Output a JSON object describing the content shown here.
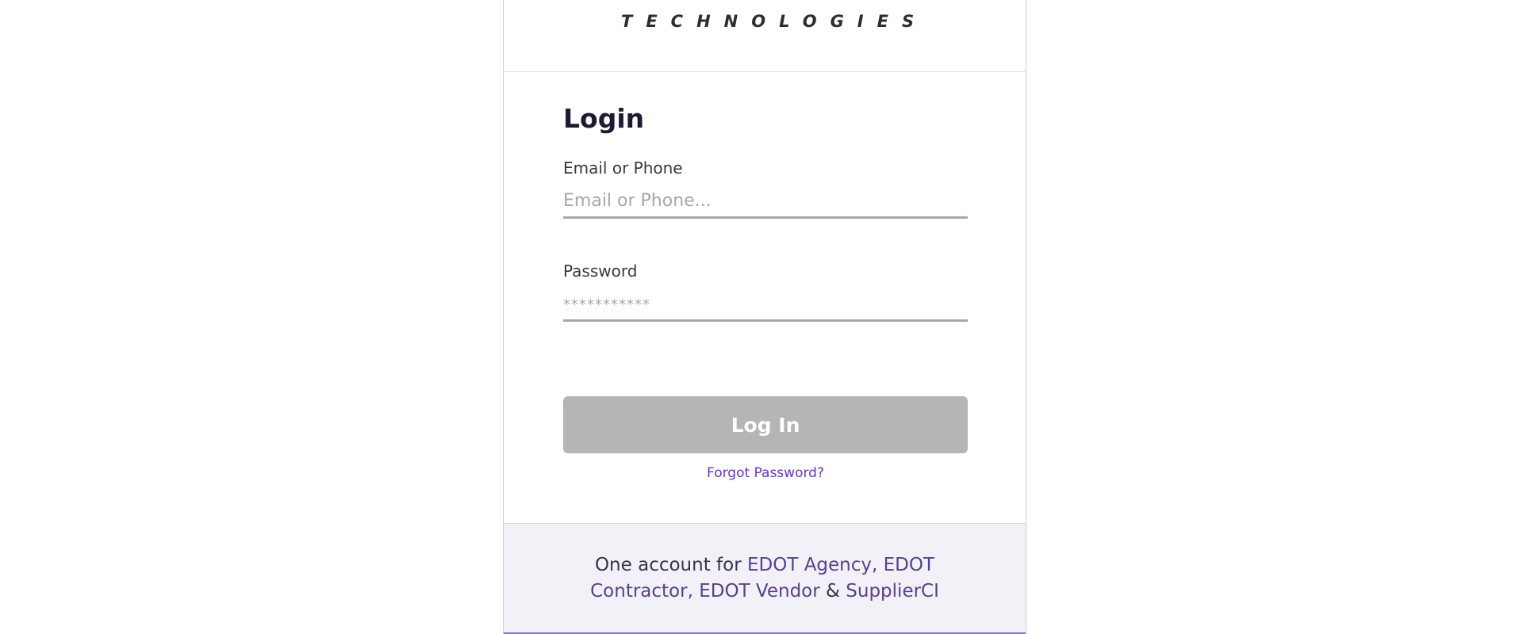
{
  "logo": {
    "tagline": "TECHNOLOGIES"
  },
  "login": {
    "title": "Login",
    "email_label": "Email or Phone",
    "email_placeholder": "Email or Phone...",
    "email_value": "",
    "password_label": "Password",
    "password_placeholder": "***********",
    "password_value": "",
    "submit_label": "Log In",
    "forgot_label": "Forgot Password?"
  },
  "footer": {
    "prefix": "One account for ",
    "link_agency": "EDOT Agency,",
    "link_contractor": "EDOT Contractor,",
    "link_vendor": "EDOT Vendor",
    "ampersand": " & ",
    "link_supplier": "SupplierCI"
  },
  "colors": {
    "accent": "#6b2fd6",
    "footer_link": "#5a3f8e",
    "button_disabled": "#b5b5b5",
    "title": "#1e1a33"
  }
}
